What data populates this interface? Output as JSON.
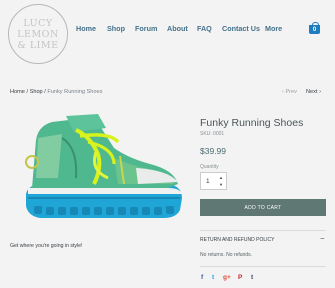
{
  "header": {
    "logo_lines": [
      "LUCY",
      "LEMON",
      "& LIME"
    ],
    "nav": [
      "Home",
      "Shop",
      "Forum",
      "About",
      "FAQ",
      "Contact Us",
      "More"
    ],
    "cart_count": "0"
  },
  "breadcrumb": {
    "home": "Home",
    "sep": "/",
    "shop": "Shop",
    "current": "Funky Running Shoes"
  },
  "pager": {
    "prev": "Prev",
    "next": "Next"
  },
  "product": {
    "title": "Funky Running Shoes",
    "sku": "SKU: 0001",
    "price": "$39.99",
    "quantity_label": "Quantity",
    "quantity_value": "1",
    "add_to_cart": "ADD TO CART",
    "description": "Get where you're going in style!"
  },
  "policy": {
    "title": "RETURN AND REFUND POLICY",
    "text": "No returns. No refunds."
  },
  "social": [
    {
      "name": "facebook-icon",
      "glyph": "f",
      "color": "#3b5998"
    },
    {
      "name": "twitter-icon",
      "glyph": "t",
      "color": "#1da1f2"
    },
    {
      "name": "google-plus-icon",
      "glyph": "g+",
      "color": "#dd4b39"
    },
    {
      "name": "pinterest-icon",
      "glyph": "P",
      "color": "#cb2027"
    },
    {
      "name": "tumblr-icon",
      "glyph": "t",
      "color": "#35465c"
    }
  ]
}
